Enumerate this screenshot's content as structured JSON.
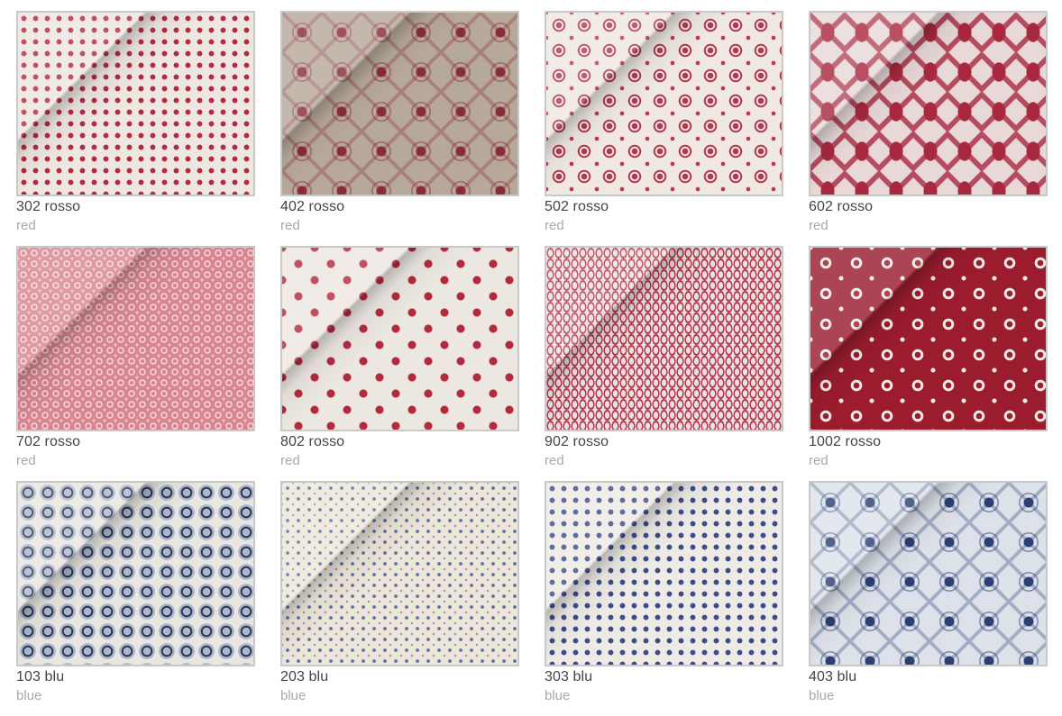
{
  "products": [
    {
      "name": "302 rosso",
      "color": "red",
      "pattern": "dots",
      "bg": "#ede6e1",
      "fg": "#b22a3e"
    },
    {
      "name": "402 rosso",
      "color": "red",
      "pattern": "tile",
      "bg": "#b7a99a",
      "fg": "#8b2a3c"
    },
    {
      "name": "502 rosso",
      "color": "red",
      "pattern": "medallion",
      "bg": "#efe8e3",
      "fg": "#b3384d"
    },
    {
      "name": "602 rosso",
      "color": "red",
      "pattern": "damask",
      "bg": "#e8d8d8",
      "fg": "#a8283f"
    },
    {
      "name": "702 rosso",
      "color": "red",
      "pattern": "lattice",
      "bg": "#d9848f",
      "fg": "#f3d9dc"
    },
    {
      "name": "802 rosso",
      "color": "red",
      "pattern": "flowers",
      "bg": "#ede7e2",
      "fg": "#b22a3e"
    },
    {
      "name": "902 rosso",
      "color": "red",
      "pattern": "ovals",
      "bg": "#ecdfdf",
      "fg": "#b3384d"
    },
    {
      "name": "1002 rosso",
      "color": "red",
      "pattern": "rings",
      "bg": "#9a1c2d",
      "fg": "#f1e9e6"
    },
    {
      "name": "103 blu",
      "color": "blue",
      "pattern": "squares",
      "bg": "#3f4656",
      "fg": "#aab7d1"
    },
    {
      "name": "203 blu",
      "color": "blue",
      "pattern": "smalldots",
      "bg": "#eee6d8",
      "fg": "#5b6fa3"
    },
    {
      "name": "303 blu",
      "color": "blue",
      "pattern": "dots",
      "bg": "#eeeae6",
      "fg": "#3b4d86"
    },
    {
      "name": "403 blu",
      "color": "blue",
      "pattern": "tile",
      "bg": "#dde2ea",
      "fg": "#2b3f74"
    }
  ]
}
